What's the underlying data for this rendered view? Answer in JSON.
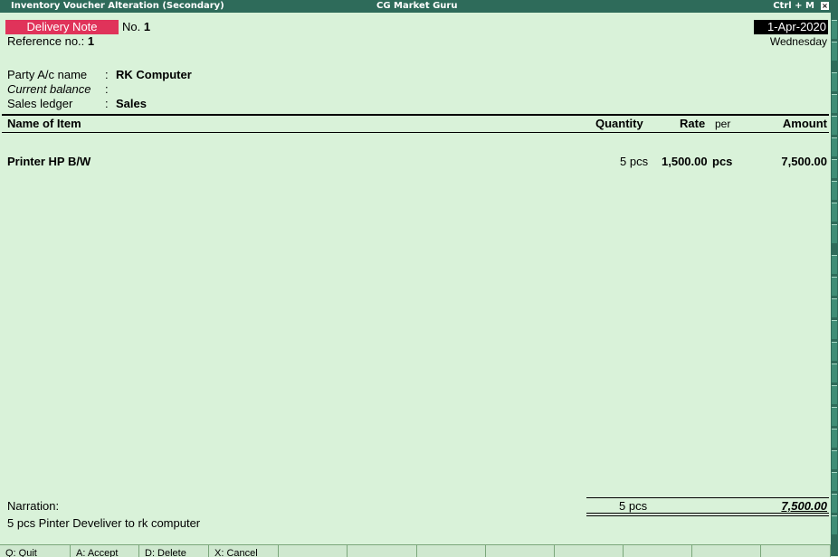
{
  "titlebar": {
    "window_title": "Inventory Voucher  Alteration  (Secondary)",
    "company": "CG Market Guru",
    "shortcut": "Ctrl + M",
    "close_glyph": "×"
  },
  "voucher": {
    "type": "Delivery Note",
    "no_label": "No.",
    "no_value": "1",
    "ref_label": "Reference no.:",
    "ref_value": "1",
    "date": "1-Apr-2020",
    "weekday": "Wednesday"
  },
  "party": {
    "party_label": "Party A/c name",
    "party_value": "RK Computer",
    "balance_label": "Current balance",
    "balance_value": "",
    "sales_label": "Sales ledger",
    "sales_value": "Sales",
    "colon": ":"
  },
  "table": {
    "headers": {
      "name": "Name of Item",
      "quantity": "Quantity",
      "rate": "Rate",
      "per": "per",
      "amount": "Amount"
    },
    "rows": [
      {
        "name": "Printer HP B/W",
        "quantity": "5 pcs",
        "rate": "1,500.00",
        "per": "pcs",
        "amount": "7,500.00"
      }
    ]
  },
  "narration": {
    "label": "Narration:",
    "text": "5 pcs Pinter Develiver to rk computer"
  },
  "totals": {
    "quantity": "5 pcs",
    "amount": "7,500.00"
  },
  "bottom_buttons": [
    {
      "label": "Q: Quit"
    },
    {
      "label": "A: Accept"
    },
    {
      "label": "D: Delete"
    },
    {
      "label": "X: Cancel"
    },
    {
      "label": ""
    },
    {
      "label": ""
    },
    {
      "label": ""
    },
    {
      "label": ""
    },
    {
      "label": ""
    },
    {
      "label": ""
    },
    {
      "label": ""
    },
    {
      "label": ""
    }
  ],
  "colors": {
    "background": "#d9f2d9",
    "titlebar": "#2e6b5a",
    "voucher_badge": "#e0335a",
    "date_box": "#000000"
  }
}
